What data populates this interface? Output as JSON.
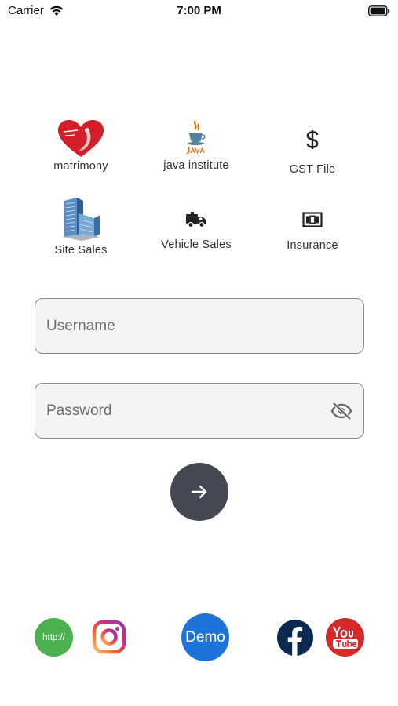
{
  "status_bar": {
    "carrier": "Carrier",
    "time": "7:00 PM"
  },
  "services": [
    {
      "label": "matrimony",
      "icon": "matrimony-heart-logo-icon"
    },
    {
      "label": "java institute",
      "icon": "java-logo-icon"
    },
    {
      "label": "GST File",
      "icon": "dollar-icon"
    },
    {
      "label": "Site Sales",
      "icon": "buildings-icon"
    },
    {
      "label": "Vehicle Sales",
      "icon": "truck-icon"
    },
    {
      "label": "Insurance",
      "icon": "money-icon"
    }
  ],
  "login": {
    "username_placeholder": "Username",
    "password_placeholder": "Password"
  },
  "social": {
    "http_label": "http://",
    "demo_label": "Demo"
  },
  "colors": {
    "submit_bg": "#454852",
    "http_green": "#4caf50",
    "demo_blue": "#1e73d9",
    "facebook_navy": "#0c2a4f",
    "youtube_red": "#d42a2a"
  }
}
